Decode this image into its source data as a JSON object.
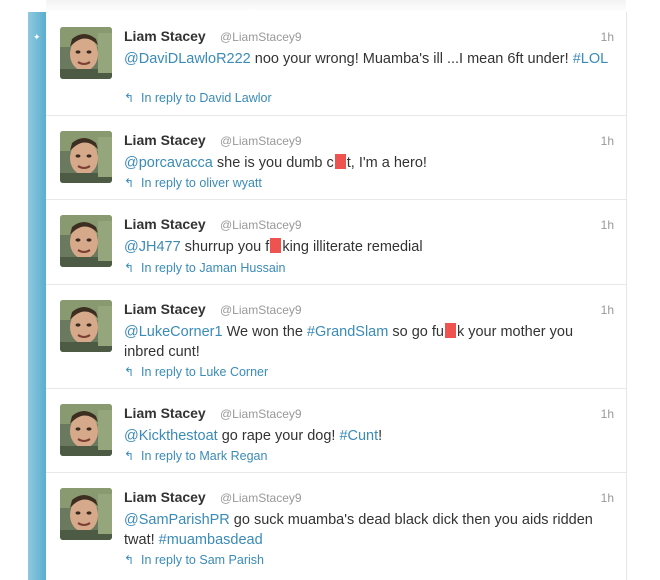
{
  "tweets": [
    {
      "name": "Liam Stacey",
      "handle": "@LiamStacey9",
      "time": "1h",
      "parts": [
        {
          "t": "m",
          "v": "@DaviDLawloR222"
        },
        {
          "t": "x",
          "v": " noo your wrong! Muamba's ill ...I mean 6ft under! "
        },
        {
          "t": "h",
          "v": "#LOL"
        }
      ],
      "reply": "In reply to David Lawlor"
    },
    {
      "name": "Liam Stacey",
      "handle": "@LiamStacey9",
      "time": "1h",
      "parts": [
        {
          "t": "m",
          "v": "@porcavacca"
        },
        {
          "t": "x",
          "v": " she is you dumb c"
        },
        {
          "t": "r"
        },
        {
          "t": "x",
          "v": "t, I'm a hero!"
        }
      ],
      "reply": "In reply to oliver wyatt"
    },
    {
      "name": "Liam Stacey",
      "handle": "@LiamStacey9",
      "time": "1h",
      "parts": [
        {
          "t": "m",
          "v": "@JH477"
        },
        {
          "t": "x",
          "v": " shurrup you f"
        },
        {
          "t": "r"
        },
        {
          "t": "x",
          "v": "king illiterate remedial"
        }
      ],
      "reply": "In reply to Jaman Hussain"
    },
    {
      "name": "Liam Stacey",
      "handle": "@LiamStacey9",
      "time": "1h",
      "parts": [
        {
          "t": "m",
          "v": "@LukeCorner1"
        },
        {
          "t": "x",
          "v": " We won the "
        },
        {
          "t": "h",
          "v": "#GrandSlam"
        },
        {
          "t": "x",
          "v": " so go fu"
        },
        {
          "t": "r"
        },
        {
          "t": "x",
          "v": "k your mother you inbred cunt!"
        }
      ],
      "reply": "In reply to Luke Corner"
    },
    {
      "name": "Liam Stacey",
      "handle": "@LiamStacey9",
      "time": "1h",
      "parts": [
        {
          "t": "m",
          "v": "@Kickthestoat"
        },
        {
          "t": "x",
          "v": " go rape your dog! "
        },
        {
          "t": "h",
          "v": "#Cunt"
        },
        {
          "t": "x",
          "v": "!"
        }
      ],
      "reply": "In reply to Mark Regan"
    },
    {
      "name": "Liam Stacey",
      "handle": "@LiamStacey9",
      "time": "1h",
      "parts": [
        {
          "t": "m",
          "v": "@SamParishPR"
        },
        {
          "t": "x",
          "v": " go suck muamba's dead black dick then you aids ridden twat! "
        },
        {
          "t": "h",
          "v": "#muambasdead"
        }
      ],
      "reply": "In reply to Sam Parish"
    }
  ],
  "icons": {
    "reply": "reply-arrow-icon",
    "avatar": "profile-photo"
  },
  "colors": {
    "link": "#3a8bb8",
    "redaction": "#ef5350",
    "sidebar": "#6cb8d6"
  }
}
